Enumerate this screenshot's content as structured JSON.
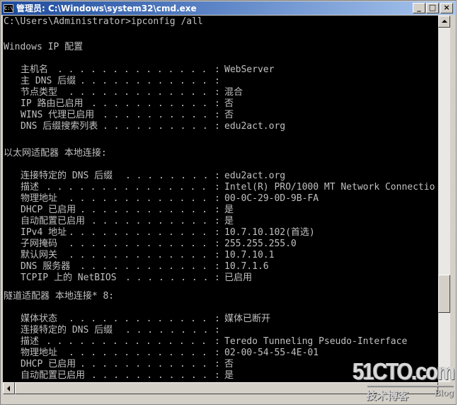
{
  "window": {
    "title": "管理员: C:\\Windows\\system32\\cmd.exe",
    "icon": "cmd-icon",
    "icon_text": "C:\\",
    "buttons": {
      "minimize": "_",
      "maximize": "□",
      "close": "×"
    }
  },
  "colors": {
    "console_bg": "#000000",
    "console_fg": "#c0c0c0",
    "titlebar_start": "#1c4a9c",
    "titlebar_end": "#a9c6ee",
    "chrome": "#d4d0c8"
  },
  "console": {
    "prompt": "C:\\Users\\Administrator>ipconfig /all",
    "sections": [
      {
        "header": "Windows IP 配置",
        "rows": [
          {
            "label": "主机名",
            "value": "WebServer"
          },
          {
            "label": "主 DNS 后缀",
            "value": ""
          },
          {
            "label": "节点类型",
            "value": "混合"
          },
          {
            "label": "IP 路由已启用",
            "value": "否"
          },
          {
            "label": "WINS 代理已启用",
            "value": "否"
          },
          {
            "label": "DNS 后缀搜索列表",
            "value": "edu2act.org"
          }
        ]
      },
      {
        "header": "以太网适配器 本地连接:",
        "rows": [
          {
            "label": "连接特定的 DNS 后缀",
            "value": "edu2act.org"
          },
          {
            "label": "描述",
            "value": "Intel(R) PRO/1000 MT Network Connectio"
          },
          {
            "label": "物理地址",
            "value": "00-0C-29-0D-9B-FA"
          },
          {
            "label": "DHCP 已启用",
            "value": "是"
          },
          {
            "label": "自动配置已启用",
            "value": "是"
          },
          {
            "label": "IPv4 地址",
            "value": "10.7.10.102(首选)"
          },
          {
            "label": "子网掩码",
            "value": "255.255.255.0"
          },
          {
            "label": "默认网关",
            "value": "10.7.10.1"
          },
          {
            "label": "DNS 服务器",
            "value": "10.7.1.6"
          },
          {
            "label": "TCPIP 上的 NetBIOS",
            "value": "已启用"
          }
        ]
      },
      {
        "header": "隧道适配器 本地连接* 8:",
        "rows": [
          {
            "label": "媒体状态",
            "value": "媒体已断开"
          },
          {
            "label": "连接特定的 DNS 后缀",
            "value": ""
          },
          {
            "label": "描述",
            "value": "Teredo Tunneling Pseudo-Interface"
          },
          {
            "label": "物理地址",
            "value": "02-00-54-55-4E-01"
          },
          {
            "label": "DHCP 已启用",
            "value": "否"
          },
          {
            "label": "自动配置已启用",
            "value": "是"
          }
        ]
      }
    ]
  },
  "scrollbar": {
    "vertical_position": 0.78,
    "vertical_visible_fraction": 0.12
  },
  "watermark": {
    "brand": "51CTO.com",
    "subtitle": "技术博客",
    "blog": "Blog"
  }
}
